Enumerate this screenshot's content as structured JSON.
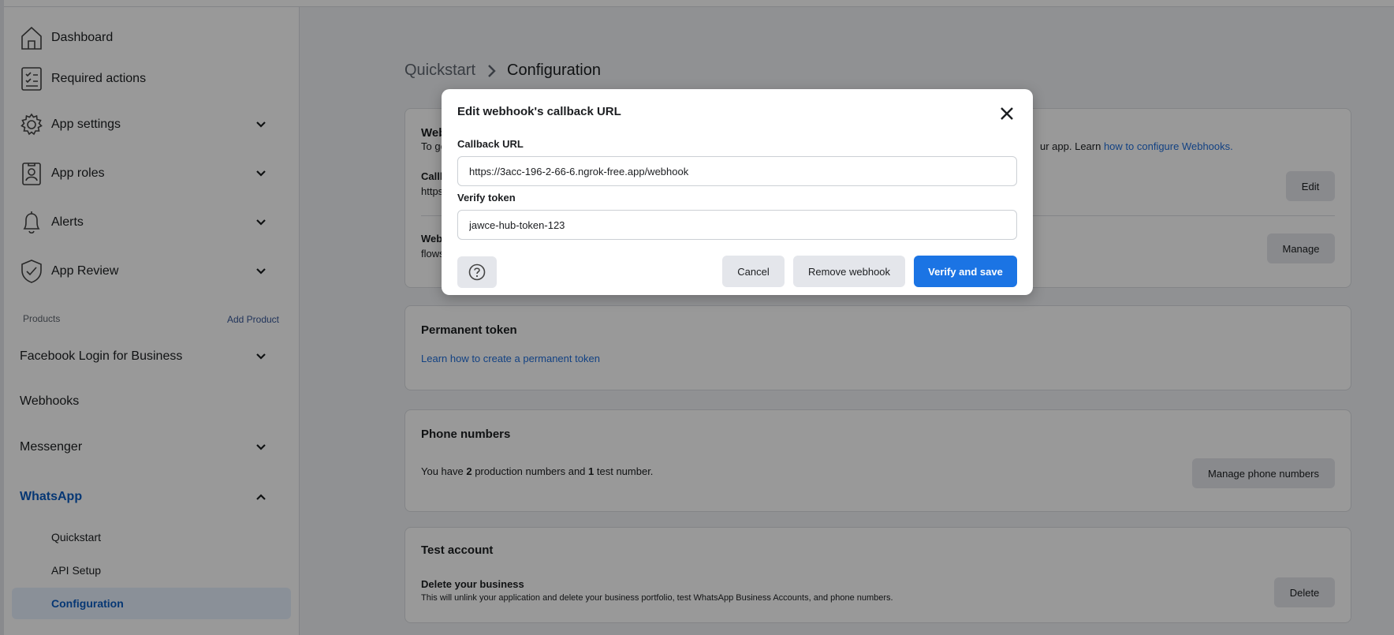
{
  "sidebar": {
    "items": [
      {
        "label": "Dashboard",
        "icon": "dashboard-icon"
      },
      {
        "label": "Required actions",
        "icon": "checklist-icon"
      },
      {
        "label": "App settings",
        "icon": "gear-icon"
      },
      {
        "label": "App roles",
        "icon": "id-badge-icon"
      },
      {
        "label": "Alerts",
        "icon": "bell-icon"
      },
      {
        "label": "App Review",
        "icon": "shield-check-icon"
      }
    ],
    "products_header": "Products",
    "add_product": "Add Product",
    "products": [
      {
        "label": "Facebook Login for Business"
      },
      {
        "label": "Webhooks"
      },
      {
        "label": "Messenger"
      },
      {
        "label": "WhatsApp"
      }
    ],
    "whatsapp_sub": [
      "Quickstart",
      "API Setup",
      "Configuration"
    ]
  },
  "breadcrumb": {
    "parent": "Quickstart",
    "current": "Configuration"
  },
  "webhook_card": {
    "title_partial": "Web",
    "desc_partial": "To ge",
    "desc_tail": "ur app. Learn ",
    "link": "how to configure Webhooks.",
    "callback_partial": "Callb",
    "url_partial": "https",
    "edit_button": "Edit",
    "fields_partial": "Webh",
    "flows_partial": "flows",
    "manage_button": "Manage"
  },
  "permanent_token": {
    "title": "Permanent token",
    "link": "Learn how to create a permanent token"
  },
  "phone_numbers": {
    "title": "Phone numbers",
    "text_pre": "You have ",
    "production_count": "2",
    "text_mid": " production numbers and ",
    "test_count": "1",
    "text_post": " test number.",
    "button": "Manage phone numbers"
  },
  "test_account": {
    "title": "Test account",
    "subtitle": "Delete your business",
    "description": "This will unlink your application and delete your business portfolio, test WhatsApp Business Accounts, and phone numbers.",
    "button": "Delete"
  },
  "modal": {
    "title": "Edit webhook's callback URL",
    "callback_label": "Callback URL",
    "callback_value": "https://3acc-196-2-66-6.ngrok-free.app/webhook",
    "verify_label": "Verify token",
    "verify_value": "jawce-hub-token-123",
    "cancel": "Cancel",
    "remove": "Remove webhook",
    "verify_save": "Verify and save"
  },
  "colors": {
    "accent": "#1b74e4",
    "link": "#216fdb",
    "active_bg": "#e7f0fd"
  }
}
